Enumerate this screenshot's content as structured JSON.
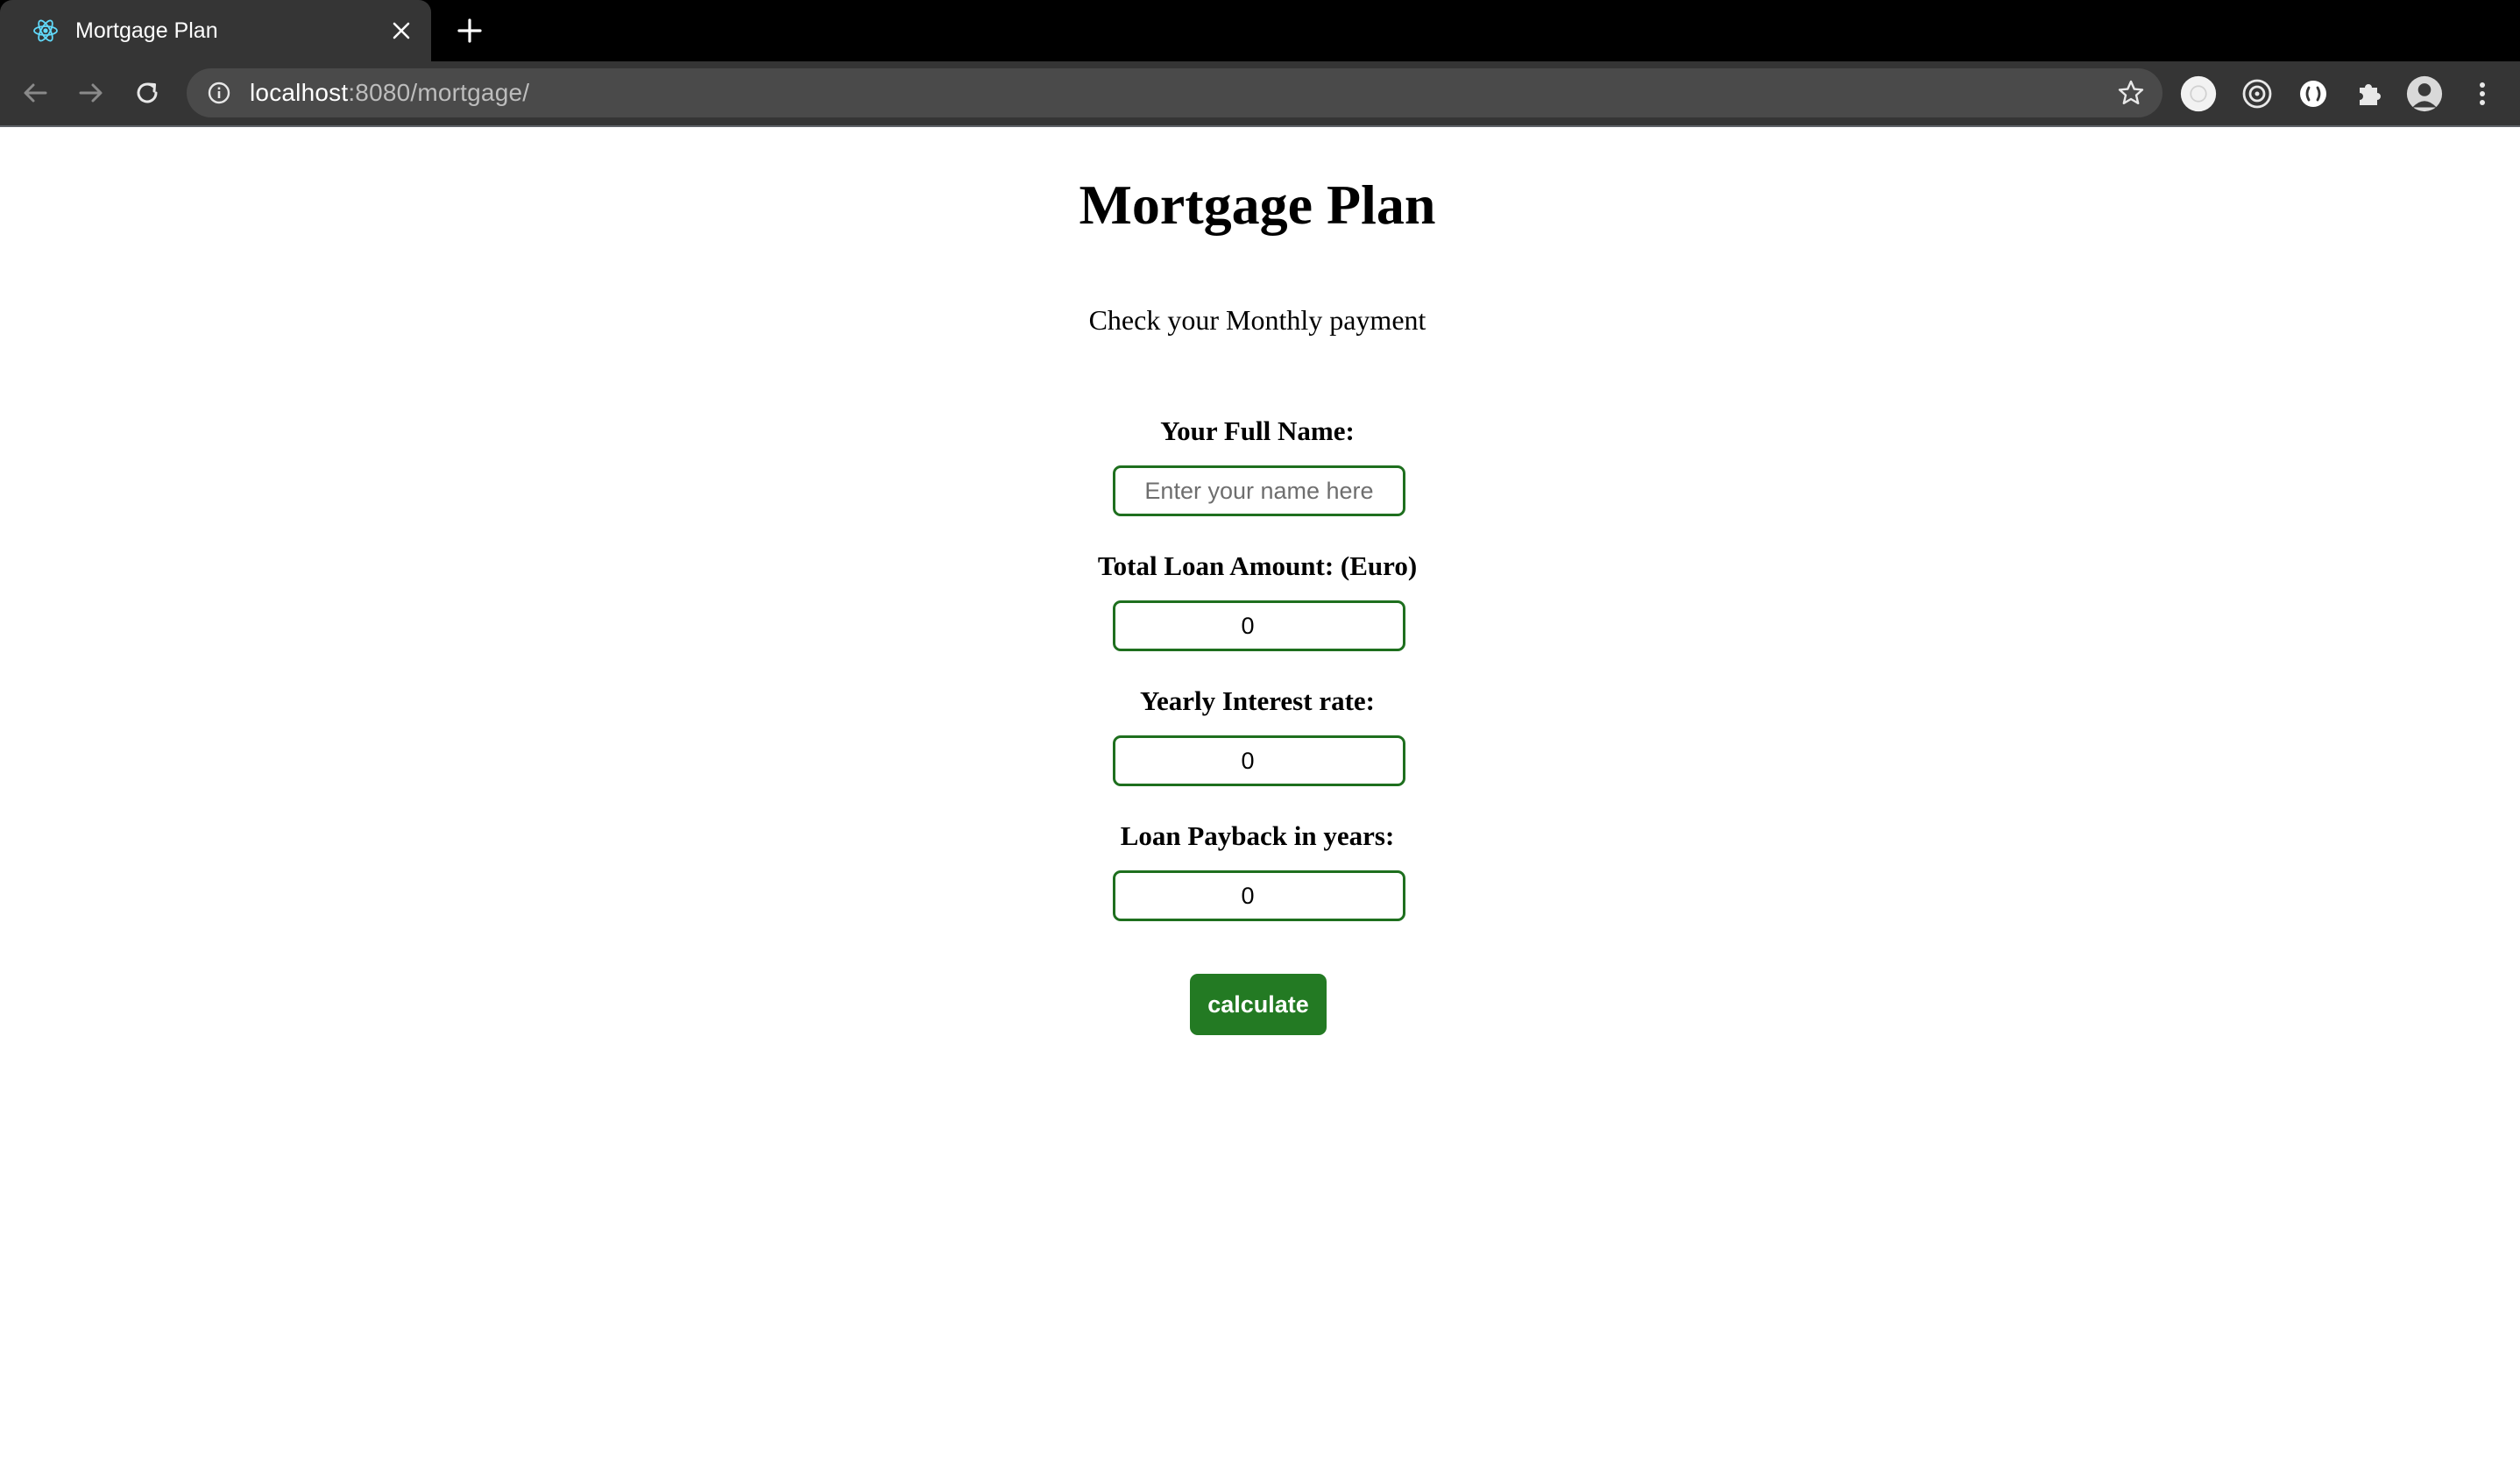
{
  "browser": {
    "tab_title": "Mortgage Plan",
    "url_host": "localhost",
    "url_path": ":8080/mortgage/",
    "icons": {
      "favicon": "react-icon",
      "close": "close-icon",
      "new_tab": "plus-icon",
      "back": "back-arrow-icon",
      "forward": "forward-arrow-icon",
      "reload": "reload-icon",
      "info": "info-icon",
      "bookmark": "star-icon",
      "extensions": [
        "extension-circle-icon",
        "target-icon",
        "extension-badge-icon",
        "puzzle-icon",
        "profile-avatar-icon",
        "kebab-menu-icon"
      ]
    }
  },
  "page": {
    "title": "Mortgage Plan",
    "subtitle": "Check your Monthly payment",
    "fields": [
      {
        "label": "Your Full Name:",
        "value": "",
        "placeholder": "Enter your name here"
      },
      {
        "label": "Total Loan Amount: (Euro)",
        "value": "0",
        "placeholder": ""
      },
      {
        "label": "Yearly Interest rate:",
        "value": "0",
        "placeholder": ""
      },
      {
        "label": "Loan Payback in years:",
        "value": "0",
        "placeholder": ""
      }
    ],
    "calculate_label": "calculate",
    "colors": {
      "accent": "#237a23",
      "input_border": "#1e6f1e"
    }
  }
}
